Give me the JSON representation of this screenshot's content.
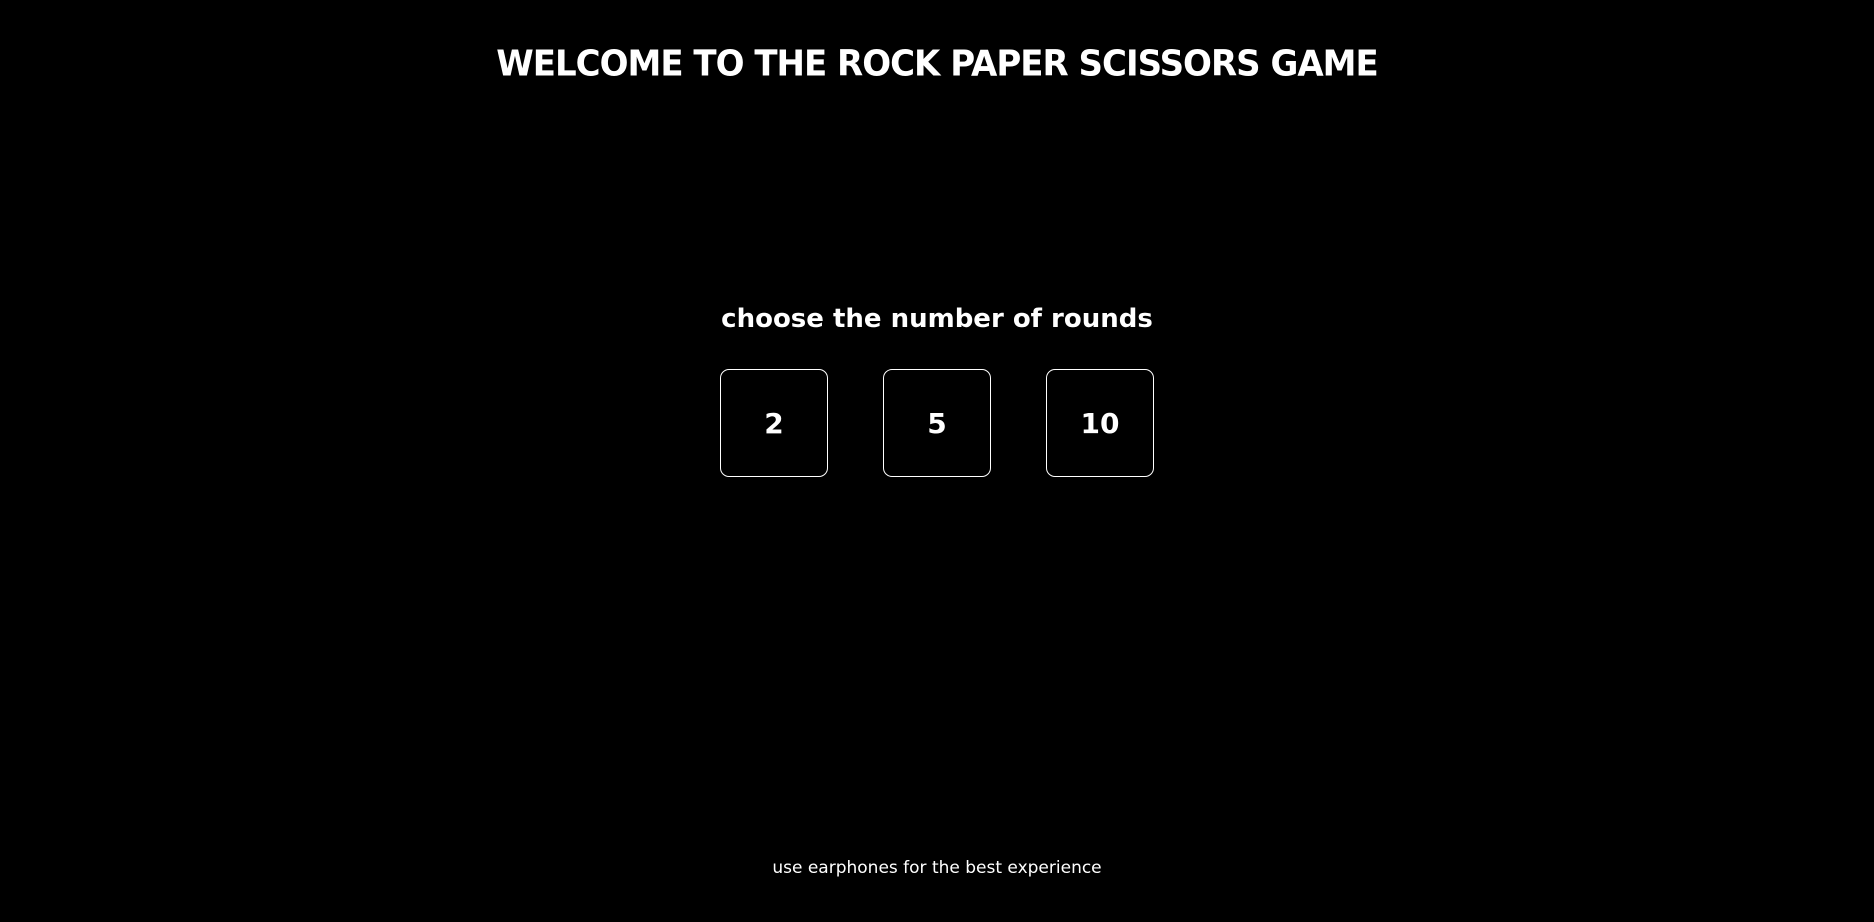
{
  "header": {
    "title": "WELCOME TO THE ROCK PAPER SCISSORS GAME"
  },
  "rounds": {
    "prompt": "choose the number of rounds",
    "options": [
      "2",
      "5",
      "10"
    ]
  },
  "footer": {
    "note": "use earphones for the best experience"
  },
  "colors": {
    "background": "#000000",
    "text": "#ffffff",
    "border": "#ffffff"
  }
}
